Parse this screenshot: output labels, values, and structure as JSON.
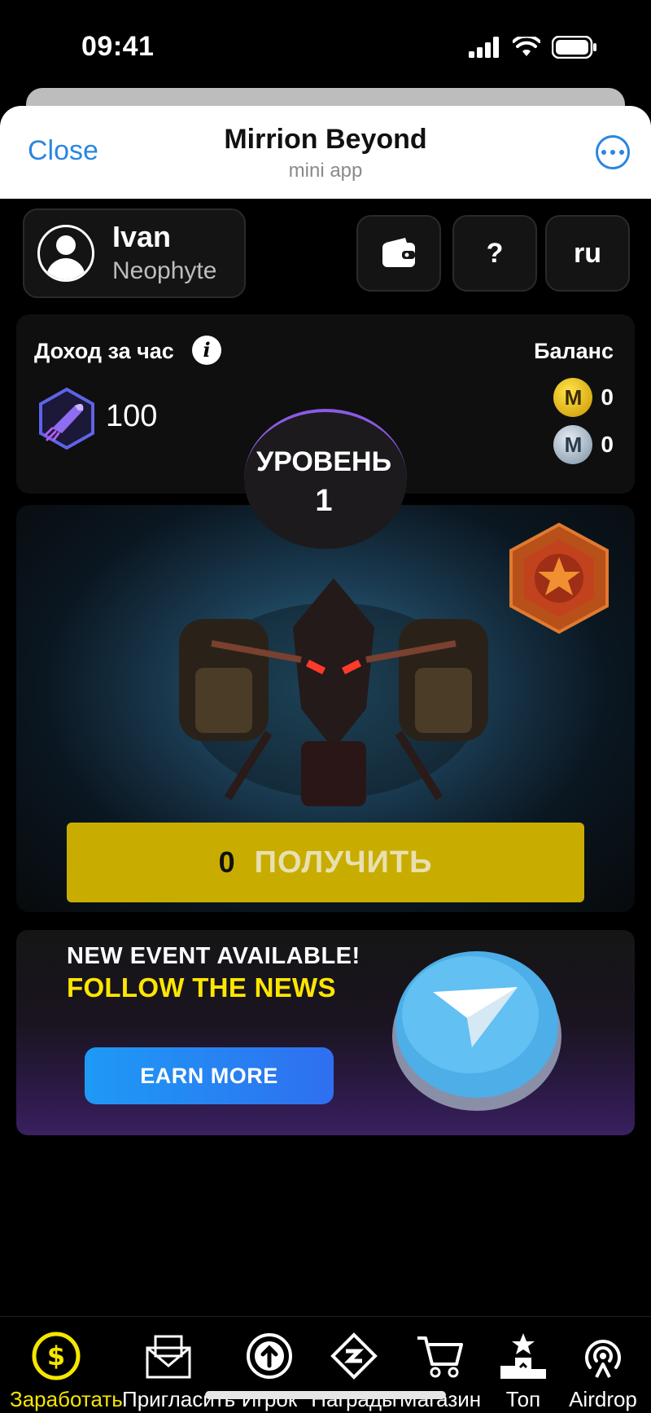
{
  "status_bar": {
    "time": "09:41"
  },
  "header": {
    "close_label": "Close",
    "title": "Mirrion Beyond",
    "subtitle": "mini app"
  },
  "profile": {
    "name": "Ivan",
    "rank": "Neophyte"
  },
  "top_buttons": {
    "wallet_icon": "wallet-icon",
    "help_label": "?",
    "language_label": "ru"
  },
  "stats": {
    "income_label": "Доход за час",
    "income_value": "100",
    "balance_label": "Баланс",
    "gold_balance": "0",
    "silver_balance": "0"
  },
  "level": {
    "label": "УРОВЕНЬ",
    "value": "1"
  },
  "claim": {
    "amount": "0",
    "label": "ПОЛУЧИТЬ"
  },
  "promo": {
    "line1": "NEW EVENT AVAILABLE!",
    "line2": "FOLLOW THE NEWS",
    "button_label": "EARN MORE"
  },
  "nav": {
    "items": [
      {
        "label": "Заработать",
        "icon": "dollar-coin-icon",
        "active": true
      },
      {
        "label": "Пригласить",
        "icon": "envelope-icon"
      },
      {
        "label": "Игрок",
        "icon": "arrow-up-circle-icon"
      },
      {
        "label": "Награды",
        "icon": "reward-diamond-icon"
      },
      {
        "label": "Магазин",
        "icon": "cart-icon"
      },
      {
        "label": "Топ",
        "icon": "leaderboard-icon"
      },
      {
        "label": "Airdrop",
        "icon": "airdrop-icon"
      }
    ],
    "active_color": "#f5e600"
  },
  "colors": {
    "accent_blue": "#2b86e0",
    "claim_yellow": "#c8ad00",
    "level_ring": "#8b5be6"
  }
}
